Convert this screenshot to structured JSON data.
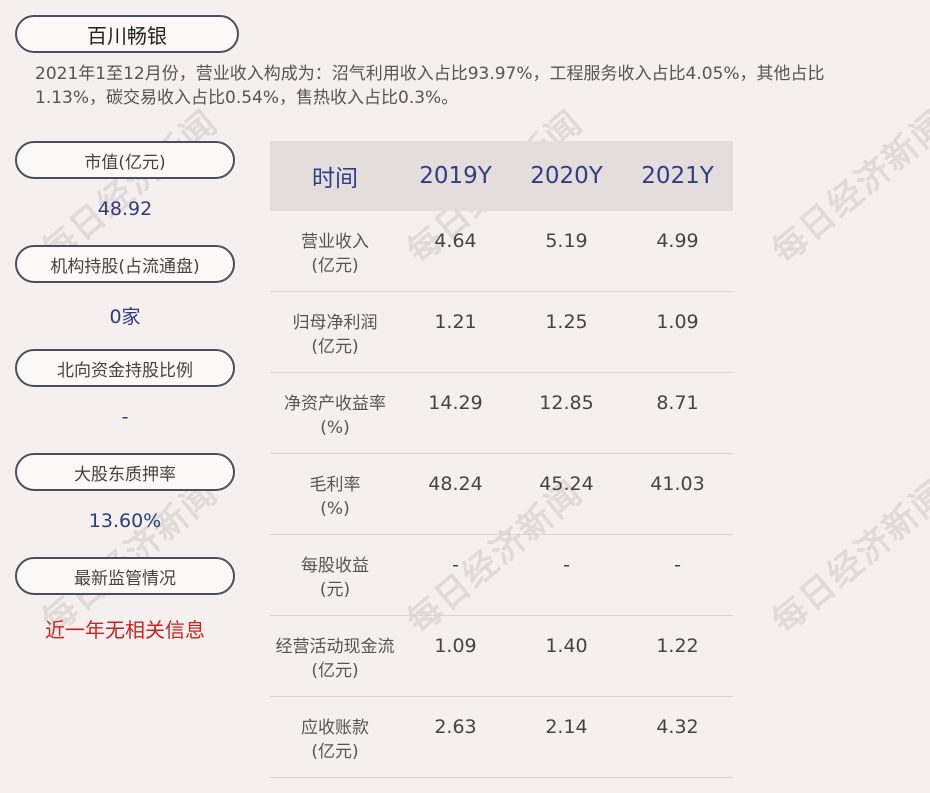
{
  "company": "百川畅银",
  "summary": "2021年1至12月份，营业收入构成为：沼气利用收入占比93.97%，工程服务收入占比4.05%，其他占比1.13%，碳交易收入占比0.54%，售热收入占比0.3%。",
  "side": [
    {
      "label": "市值(亿元)",
      "value": "48.92"
    },
    {
      "label": "机构持股(占流通盘)",
      "value": "0家"
    },
    {
      "label": "北向资金持股比例",
      "value": "-"
    },
    {
      "label": "大股东质押率",
      "value": "13.60%"
    },
    {
      "label": "最新监管情况",
      "value": "近一年无相关信息"
    }
  ],
  "table": {
    "headers": [
      "时间",
      "2019Y",
      "2020Y",
      "2021Y"
    ],
    "rows": [
      {
        "label1": "营业收入",
        "label2": "(亿元)",
        "values": [
          "4.64",
          "5.19",
          "4.99"
        ]
      },
      {
        "label1": "归母净利润",
        "label2": "(亿元)",
        "values": [
          "1.21",
          "1.25",
          "1.09"
        ]
      },
      {
        "label1": "净资产收益率",
        "label2": "(%)",
        "values": [
          "14.29",
          "12.85",
          "8.71"
        ]
      },
      {
        "label1": "毛利率",
        "label2": "(%)",
        "values": [
          "48.24",
          "45.24",
          "41.03"
        ]
      },
      {
        "label1": "每股收益",
        "label2": "(元)",
        "values": [
          "-",
          "-",
          "-"
        ]
      },
      {
        "label1": "经营活动现金流",
        "label2": "(亿元)",
        "values": [
          "1.09",
          "1.40",
          "1.22"
        ]
      },
      {
        "label1": "应收账款",
        "label2": "(亿元)",
        "values": [
          "2.63",
          "2.14",
          "4.32"
        ]
      }
    ]
  },
  "watermark": "每日经济新闻"
}
